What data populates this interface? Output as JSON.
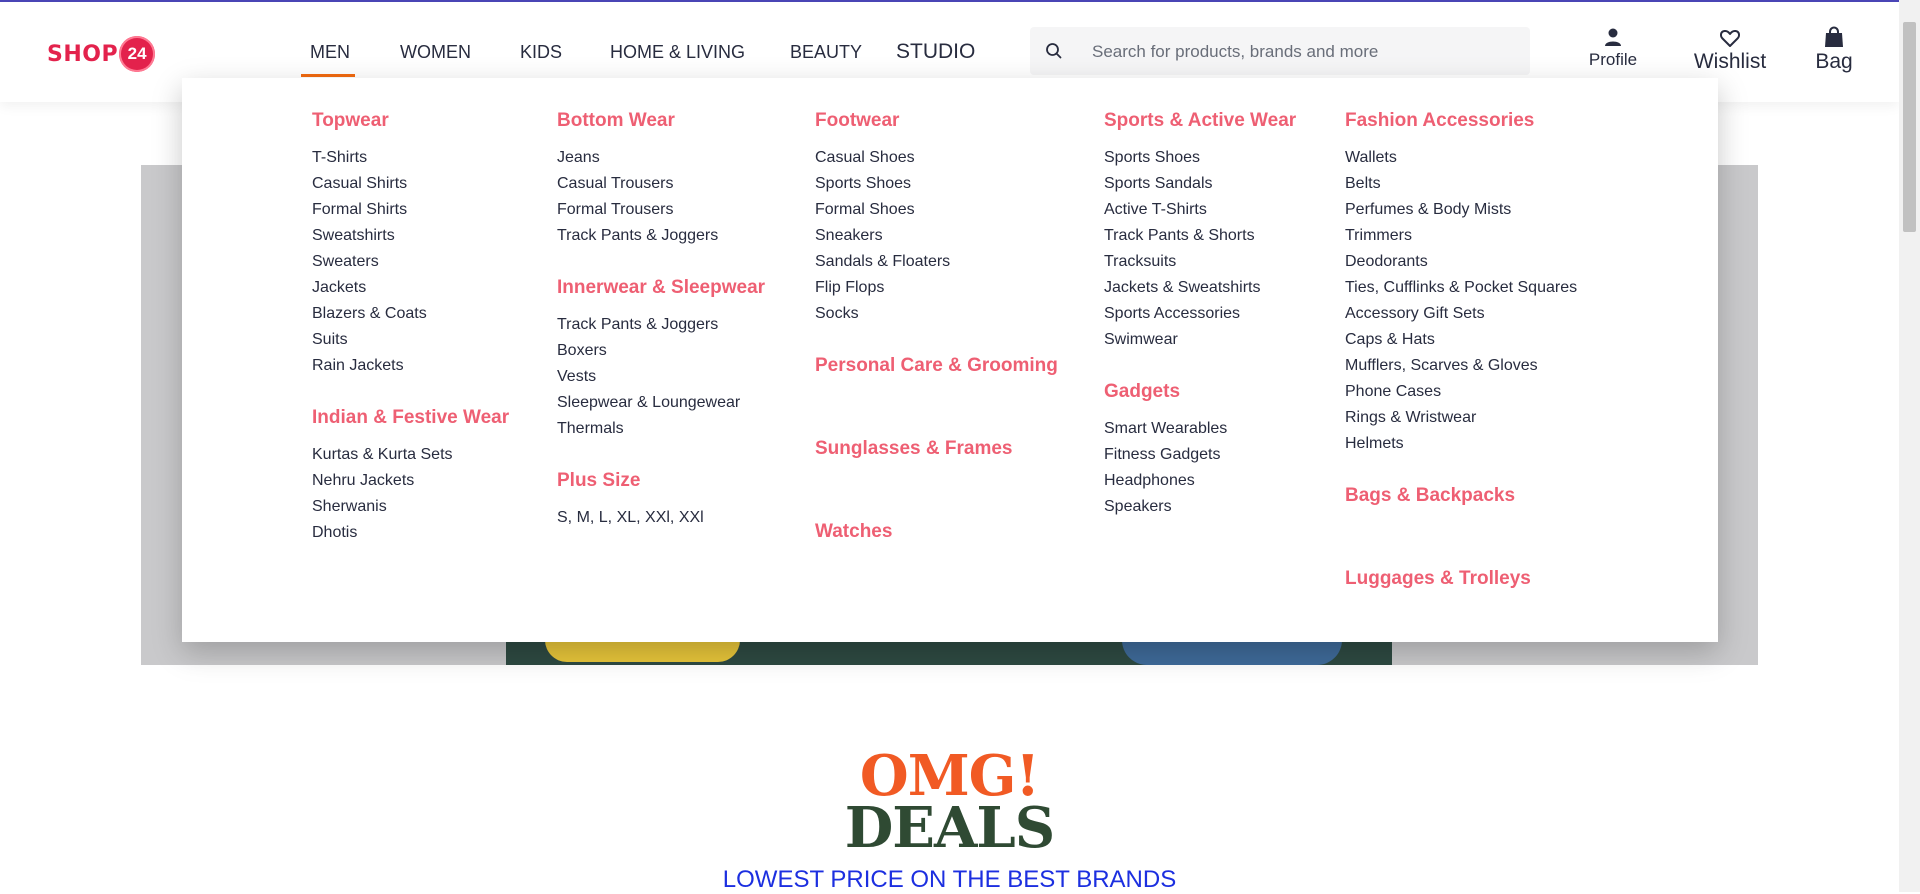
{
  "brand": {
    "logo_text": "SHOP",
    "logo_badge": "24",
    "accent": "#e3224c"
  },
  "nav": {
    "items": [
      {
        "label": "MEN"
      },
      {
        "label": "WOMEN"
      },
      {
        "label": "KIDS"
      },
      {
        "label": "HOME & LIVING"
      },
      {
        "label": "BEAUTY"
      },
      {
        "label": "STUDIO"
      }
    ],
    "active": "MEN"
  },
  "search": {
    "placeholder": "Search for products, brands and more",
    "icon": "search-icon"
  },
  "actions": {
    "profile": {
      "label": "Profile",
      "icon": "person-icon"
    },
    "wishlist": {
      "label": "Wishlist",
      "icon": "heart-icon"
    },
    "bag": {
      "label": "Bag",
      "icon": "bag-icon"
    }
  },
  "mega": {
    "columns": [
      {
        "sections": [
          {
            "title": "Topwear",
            "items": [
              "T-Shirts",
              "Casual Shirts",
              "Formal Shirts",
              "Sweatshirts",
              "Sweaters",
              "Jackets",
              "Blazers & Coats",
              "Suits",
              "Rain Jackets"
            ]
          },
          {
            "title": "Indian & Festive Wear",
            "items": [
              "Kurtas & Kurta Sets",
              "Nehru Jackets",
              "Sherwanis",
              "Dhotis"
            ]
          }
        ]
      },
      {
        "sections": [
          {
            "title": "Bottom Wear",
            "items": [
              "Jeans",
              "Casual Trousers",
              "Formal Trousers",
              "Track Pants & Joggers"
            ]
          },
          {
            "title": "Innerwear & Sleepwear",
            "items": [
              "Track Pants & Joggers",
              "Boxers",
              "Vests",
              "Sleepwear & Loungewear",
              "Thermals"
            ]
          },
          {
            "title": "Plus Size",
            "items": [
              "S, M, L, XL, XXl, XXl"
            ]
          }
        ]
      },
      {
        "sections": [
          {
            "title": "Footwear",
            "items": [
              "Casual Shoes",
              "Sports Shoes",
              "Formal Shoes",
              "Sneakers",
              "Sandals & Floaters",
              "Flip Flops",
              "Socks"
            ]
          },
          {
            "title": "Personal Care & Grooming",
            "items": []
          },
          {
            "title": "Sunglasses & Frames",
            "items": []
          },
          {
            "title": "Watches",
            "items": []
          }
        ]
      },
      {
        "sections": [
          {
            "title": "Sports & Active Wear",
            "items": [
              "Sports Shoes",
              "Sports Sandals",
              "Active T-Shirts",
              "Track Pants & Shorts",
              "Tracksuits",
              "Jackets & Sweatshirts",
              "Sports Accessories",
              "Swimwear"
            ]
          },
          {
            "title": "Gadgets",
            "items": [
              "Smart Wearables",
              "Fitness Gadgets",
              "Headphones",
              "Speakers"
            ]
          }
        ]
      },
      {
        "sections": [
          {
            "title": "Fashion Accessories",
            "items": [
              "Wallets",
              "Belts",
              "Perfumes & Body Mists",
              "Trimmers",
              "Deodorants",
              "Ties, Cufflinks & Pocket Squares",
              "Accessory Gift Sets",
              "Caps & Hats",
              "Mufflers, Scarves & Gloves",
              "Phone Cases",
              "Rings & Wristwear",
              "Helmets"
            ]
          },
          {
            "title": "Bags & Backpacks",
            "items": []
          },
          {
            "title": "Luggages & Trolleys",
            "items": []
          }
        ]
      }
    ]
  },
  "promo": {
    "line1": "OMG!",
    "line2": "DEALS",
    "tagline": "LOWEST PRICE ON THE BEST BRANDS"
  }
}
